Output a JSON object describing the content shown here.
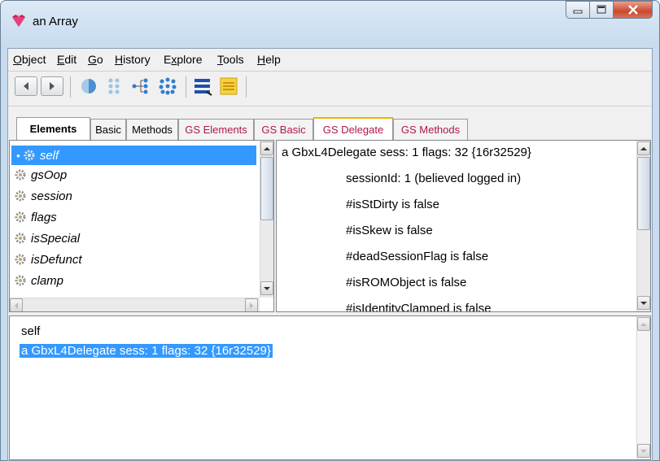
{
  "window": {
    "title": "an Array"
  },
  "menu": [
    {
      "label": "Object",
      "underline": "O",
      "rest": "bject"
    },
    {
      "label": "Edit",
      "underline": "E",
      "rest": "dit"
    },
    {
      "label": "Go",
      "underline": "G",
      "rest": "o"
    },
    {
      "label": "History",
      "underline": "H",
      "rest": "istory"
    },
    {
      "label": "Explore",
      "underline": "x",
      "pre": "E",
      "rest": "plore"
    },
    {
      "label": "Tools",
      "underline": "T",
      "rest": "ools"
    },
    {
      "label": "Help",
      "underline": "H",
      "rest": "elp"
    }
  ],
  "tabs": [
    "Elements",
    "Basic",
    "Methods",
    "GS Elements",
    "GS Basic",
    "GS Delegate",
    "GS Methods"
  ],
  "selected_tab": "GS Delegate",
  "variables": [
    "self",
    "gsOop",
    "session",
    "flags",
    "isSpecial",
    "isDefunct",
    "clamp"
  ],
  "selected_variable": "self",
  "detail_lines": [
    "a GbxL4Delegate sess: 1 flags: 32 {16r32529}",
    "sessionId: 1 (believed logged in)",
    "#isStDirty is false",
    "#isSkew is false",
    "#deadSessionFlag is false",
    "#isROMObject is false",
    "#isIdentityClamped is false"
  ],
  "bottom": {
    "line1": "self",
    "line2": "a GbxL4Delegate sess: 1 flags: 32 {16r32529}"
  },
  "colors": {
    "accent": "#3399ff",
    "gs_tab_text": "#b0174b",
    "selected_tab_border": "#f0b400"
  }
}
